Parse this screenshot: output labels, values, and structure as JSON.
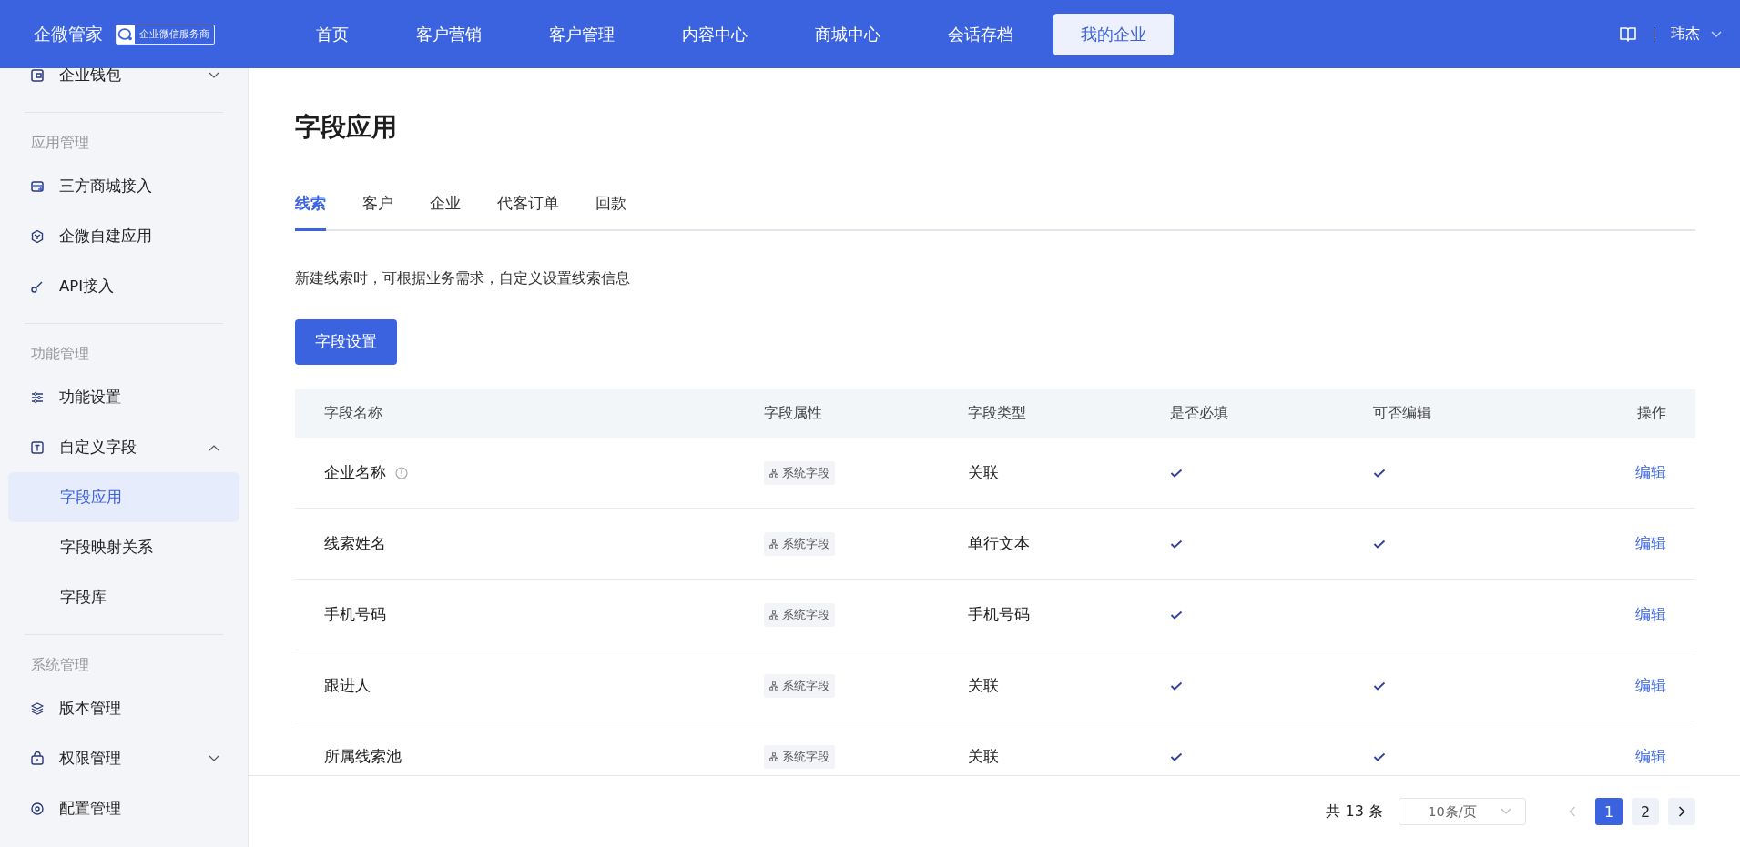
{
  "header": {
    "brand": "企微管家",
    "badge": "企业微信服务商",
    "nav": [
      {
        "label": "首页",
        "selected": false
      },
      {
        "label": "客户营销",
        "selected": false
      },
      {
        "label": "客户管理",
        "selected": false
      },
      {
        "label": "内容中心",
        "selected": false
      },
      {
        "label": "商城中心",
        "selected": false
      },
      {
        "label": "会话存档",
        "selected": false
      },
      {
        "label": "我的企业",
        "selected": true
      }
    ],
    "user": "玮杰"
  },
  "sidebar": {
    "sections": [
      {
        "items": [
          {
            "label": "企业钱包",
            "expanded": false,
            "selected": false
          }
        ]
      },
      {
        "title": "应用管理",
        "items": [
          {
            "label": "三方商城接入",
            "selected": false
          },
          {
            "label": "企微自建应用",
            "selected": false
          },
          {
            "label": "API接入",
            "selected": false
          }
        ]
      },
      {
        "title": "功能管理",
        "items": [
          {
            "label": "功能设置",
            "selected": false
          },
          {
            "label": "自定义字段",
            "expanded": true,
            "selected": false,
            "children": [
              {
                "label": "字段应用",
                "selected": true
              },
              {
                "label": "字段映射关系",
                "selected": false
              },
              {
                "label": "字段库",
                "selected": false
              }
            ]
          }
        ]
      },
      {
        "title": "系统管理",
        "items": [
          {
            "label": "版本管理",
            "selected": false
          },
          {
            "label": "权限管理",
            "expanded": false,
            "selected": false
          },
          {
            "label": "配置管理",
            "selected": false
          }
        ]
      }
    ]
  },
  "page": {
    "title": "字段应用",
    "tabs": [
      {
        "label": "线索",
        "selected": true
      },
      {
        "label": "客户",
        "selected": false
      },
      {
        "label": "企业",
        "selected": false
      },
      {
        "label": "代客订单",
        "selected": false
      },
      {
        "label": "回款",
        "selected": false
      }
    ],
    "description": "新建线索时，可根据业务需求，自定义设置线索信息",
    "button": "字段设置",
    "table": {
      "columns": [
        "字段名称",
        "字段属性",
        "字段类型",
        "是否必填",
        "可否编辑",
        "操作"
      ],
      "rows": [
        {
          "name": "企业名称",
          "info": true,
          "attribute": "系统字段",
          "type": "关联",
          "required": true,
          "editable": true,
          "action": "编辑"
        },
        {
          "name": "线索姓名",
          "info": false,
          "attribute": "系统字段",
          "type": "单行文本",
          "required": true,
          "editable": true,
          "action": "编辑"
        },
        {
          "name": "手机号码",
          "info": false,
          "attribute": "系统字段",
          "type": "手机号码",
          "required": true,
          "editable": false,
          "action": "编辑"
        },
        {
          "name": "跟进人",
          "info": false,
          "attribute": "系统字段",
          "type": "关联",
          "required": true,
          "editable": true,
          "action": "编辑"
        },
        {
          "name": "所属线索池",
          "info": false,
          "attribute": "系统字段",
          "type": "关联",
          "required": true,
          "editable": true,
          "action": "编辑"
        }
      ]
    },
    "pagination": {
      "total": "共 13 条",
      "page_size": "10条/页",
      "prev_disabled": true,
      "pages": [
        {
          "label": "1",
          "selected": true
        },
        {
          "label": "2",
          "selected": false
        }
      ]
    }
  }
}
